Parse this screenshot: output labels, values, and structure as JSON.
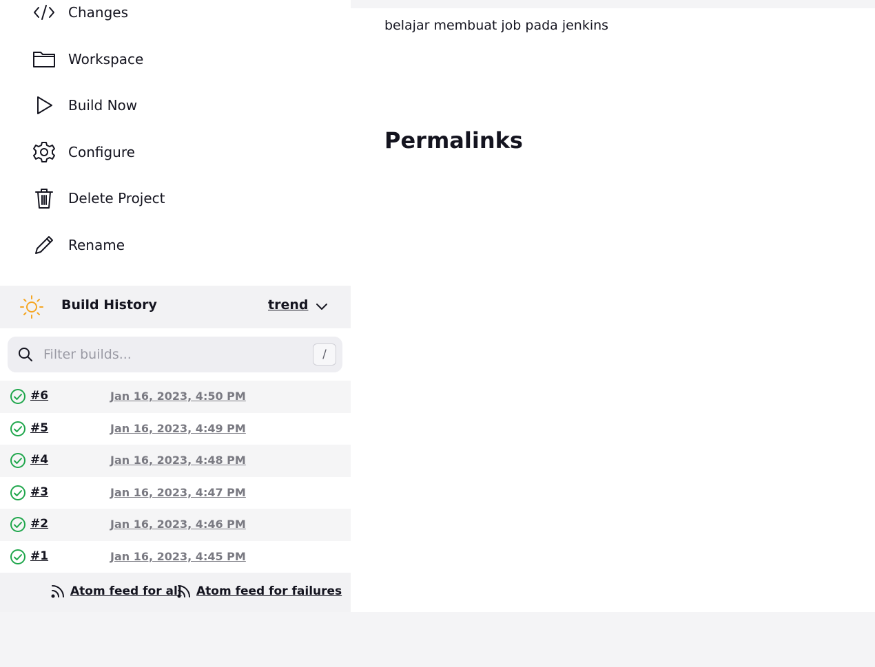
{
  "sidebar": {
    "tasks": [
      {
        "label": "Changes",
        "icon": "code-icon"
      },
      {
        "label": "Workspace",
        "icon": "folder-icon"
      },
      {
        "label": "Build Now",
        "icon": "play-icon"
      },
      {
        "label": "Configure",
        "icon": "gear-icon"
      },
      {
        "label": "Delete Project",
        "icon": "trash-icon"
      },
      {
        "label": "Rename",
        "icon": "pencil-icon"
      }
    ]
  },
  "build_history": {
    "title": "Build History",
    "trend_label": "trend",
    "status_icon": "sun-icon",
    "filter": {
      "placeholder": "Filter builds...",
      "shortcut": "/"
    },
    "builds": [
      {
        "number": "#6",
        "date": "Jan 16, 2023, 4:50 PM",
        "status": "success"
      },
      {
        "number": "#5",
        "date": "Jan 16, 2023, 4:49 PM",
        "status": "success"
      },
      {
        "number": "#4",
        "date": "Jan 16, 2023, 4:48 PM",
        "status": "success"
      },
      {
        "number": "#3",
        "date": "Jan 16, 2023, 4:47 PM",
        "status": "success"
      },
      {
        "number": "#2",
        "date": "Jan 16, 2023, 4:46 PM",
        "status": "success"
      },
      {
        "number": "#1",
        "date": "Jan 16, 2023, 4:45 PM",
        "status": "success"
      }
    ],
    "feeds": {
      "all": "Atom feed for all",
      "failures": "Atom feed for failures"
    }
  },
  "main": {
    "description": "belajar membuat job pada jenkins",
    "permalinks_heading": "Permalinks"
  },
  "colors": {
    "success": "#1ea64b",
    "sun": "#f5a623",
    "page_bg": "#f4f4f6",
    "text": "#14141f"
  }
}
